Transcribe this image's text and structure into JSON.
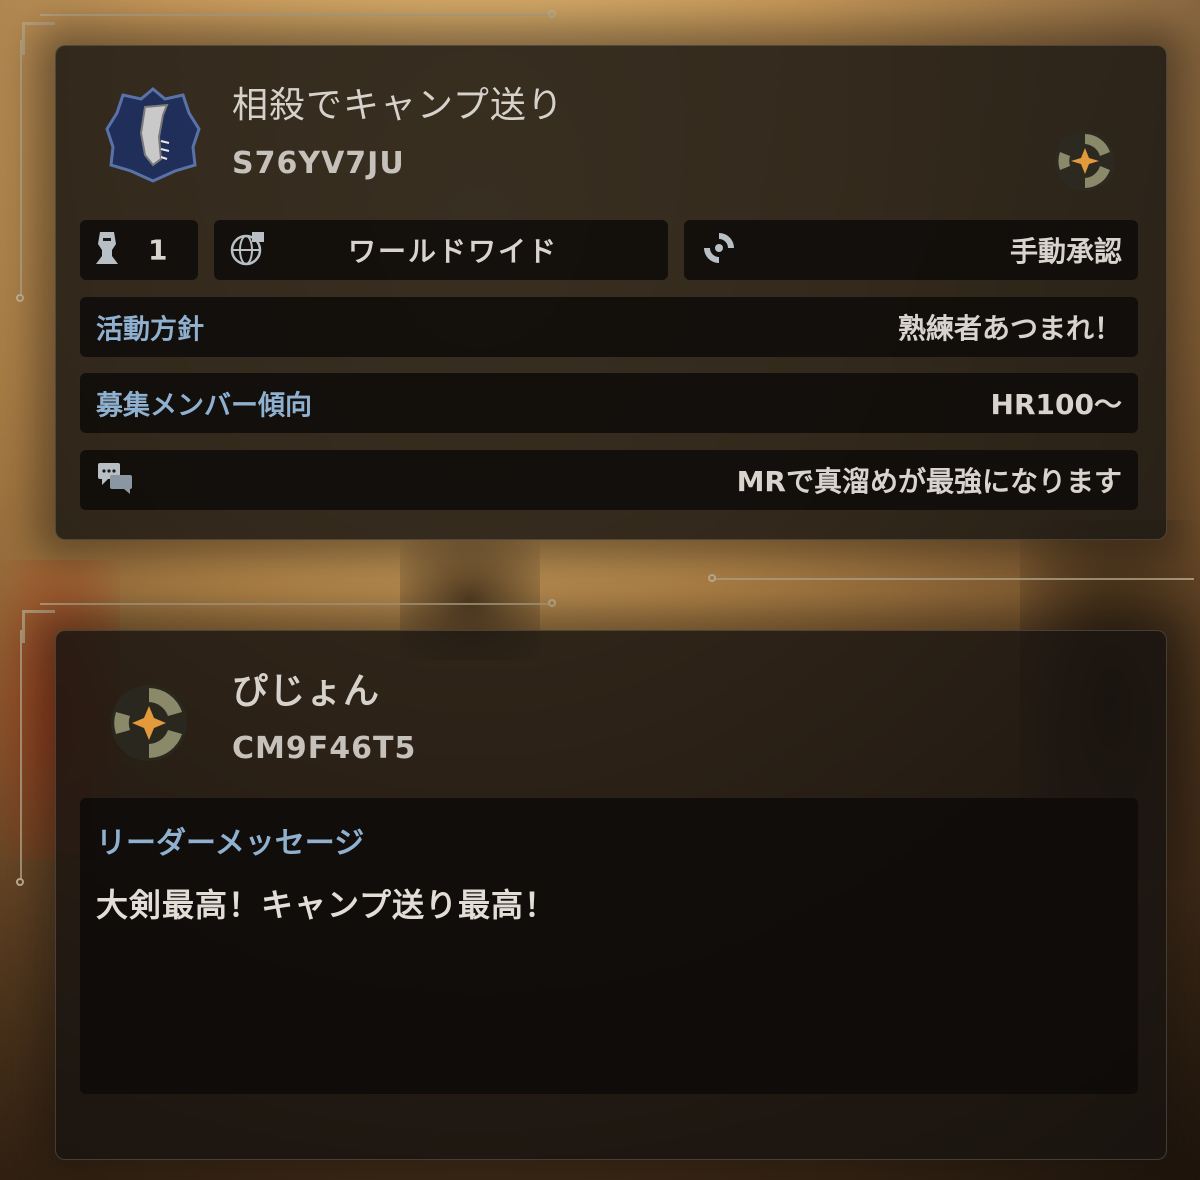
{
  "party": {
    "title": "相殺でキャンプ送り",
    "code": "S76YV7JU",
    "emblem_icon": "greatsword-shield-emblem-icon",
    "rank_icon": "star-rank-icon",
    "member_count": "1",
    "region": "ワールドワイド",
    "approval": "手動承認",
    "policy_label": "活動方針",
    "policy_value": "熟練者あつまれ！",
    "members_label": "募集メンバー傾向",
    "members_value": "HR100～",
    "comment": "MRで真溜めが最強になります"
  },
  "leader": {
    "name": "ぴじょん",
    "code": "CM9F46T5",
    "rank_icon": "star-rank-icon",
    "message_label": "リーダーメッセージ",
    "message": "大剣最高！キャンプ送り最高！"
  },
  "colors": {
    "label_blue": "#8fb0cf",
    "text": "#d8d4cd",
    "panel": "#1c1814",
    "emblem_blue": "#1f2f5a"
  }
}
